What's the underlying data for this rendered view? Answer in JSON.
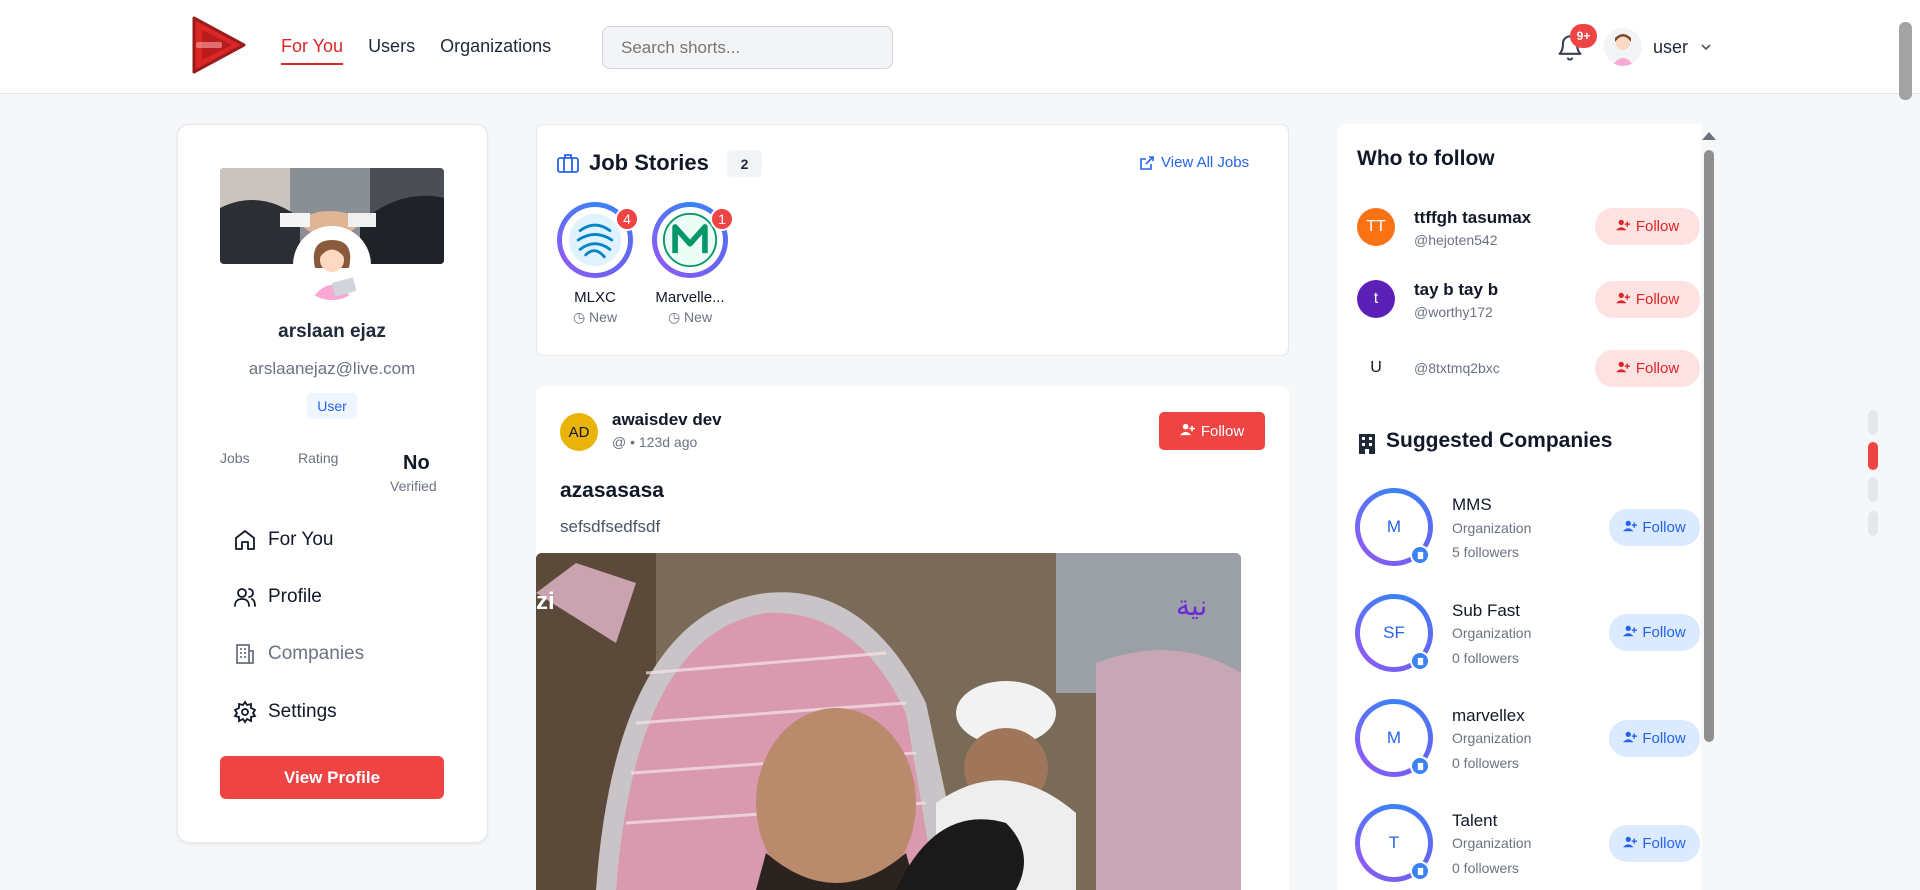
{
  "colors": {
    "brand": "#ef4444",
    "accent": "#2563eb",
    "bg": "#f5f7f9",
    "text": "#111827",
    "muted": "#6b7280"
  },
  "header": {
    "logo_icon": "play-logo-icon",
    "nav": [
      {
        "label": "For You",
        "active": true
      },
      {
        "label": "Users",
        "active": false
      },
      {
        "label": "Organizations",
        "active": false
      }
    ],
    "search_placeholder": "Search shorts...",
    "notification_badge": "9+",
    "user_label": "user"
  },
  "profile": {
    "name": "arslaan ejaz",
    "email": "arslaanejaz@live.com",
    "role": "User",
    "stats": {
      "jobs_label": "Jobs",
      "rating_label": "Rating",
      "verified_value": "No",
      "verified_label": "Verified"
    },
    "menu": [
      {
        "label": "For You",
        "icon": "home-icon"
      },
      {
        "label": "Profile",
        "icon": "users-icon"
      },
      {
        "label": "Companies",
        "icon": "building-icon"
      },
      {
        "label": "Settings",
        "icon": "gear-icon"
      }
    ],
    "view_profile_label": "View Profile"
  },
  "job_stories": {
    "title": "Job Stories",
    "count": "2",
    "view_all_label": "View All Jobs",
    "stories": [
      {
        "name": "MLXC",
        "badge": "4",
        "status": "New"
      },
      {
        "name": "Marvelle...",
        "badge": "1",
        "status": "New"
      }
    ]
  },
  "post": {
    "avatar_initials": "AD",
    "author": "awaisdev dev",
    "meta": "@ • 123d ago",
    "follow_label": "Follow",
    "title": "azasasasa",
    "body": "sefsdfsedfsdf"
  },
  "who_to_follow": {
    "title": "Who to follow",
    "users": [
      {
        "initials": "TT",
        "name": "ttffgh tasumax",
        "handle": "@hejoten542",
        "color": "#f97316",
        "follow_label": "Follow"
      },
      {
        "initials": "t",
        "name": "tay b tay b",
        "handle": "@worthy172",
        "color": "#5b21b6",
        "follow_label": "Follow"
      },
      {
        "initials": "U",
        "name": "",
        "handle": "@8txtmq2bxc",
        "color": "#ffffff",
        "follow_label": "Follow"
      }
    ]
  },
  "suggested_companies": {
    "title": "Suggested Companies",
    "companies": [
      {
        "initials": "M",
        "name": "MMS",
        "type": "Organization",
        "followers": "5 followers",
        "follow_label": "Follow"
      },
      {
        "initials": "SF",
        "name": "Sub Fast",
        "type": "Organization",
        "followers": "0 followers",
        "follow_label": "Follow"
      },
      {
        "initials": "M",
        "name": "marvellex",
        "type": "Organization",
        "followers": "0 followers",
        "follow_label": "Follow"
      },
      {
        "initials": "T",
        "name": "Talent",
        "type": "Organization",
        "followers": "0 followers",
        "follow_label": "Follow"
      }
    ]
  }
}
